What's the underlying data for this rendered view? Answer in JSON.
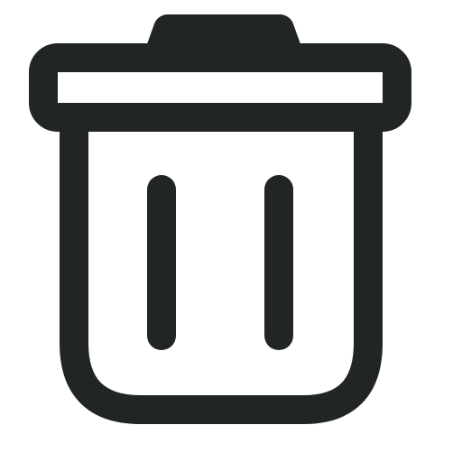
{
  "icon": {
    "name": "trash-icon",
    "stroke_color": "#212526",
    "background_color": "#ffffff"
  }
}
